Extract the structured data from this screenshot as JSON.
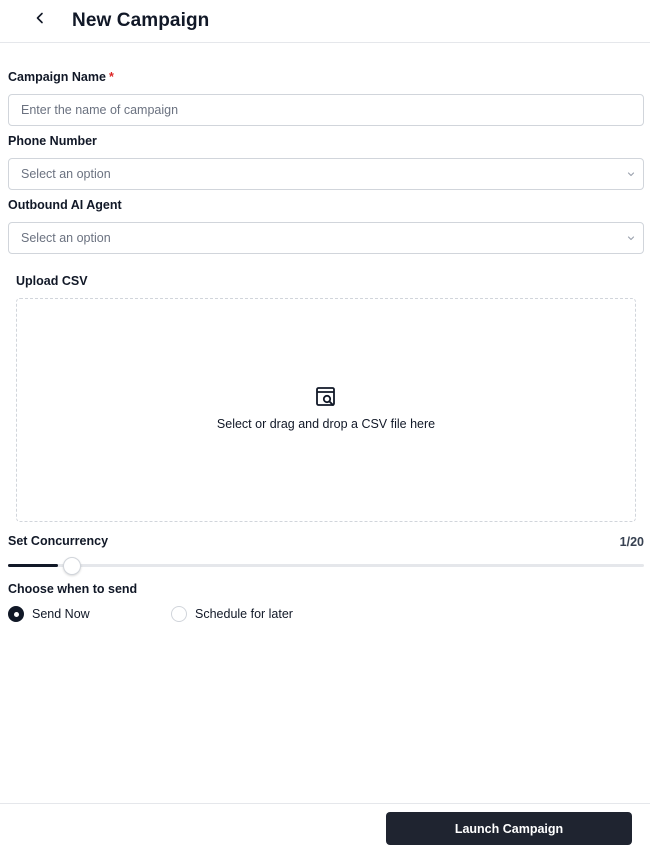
{
  "header": {
    "title": "New Campaign",
    "back_icon": "chevron-left-icon"
  },
  "form": {
    "campaign_name": {
      "label": "Campaign Name",
      "required_marker": "*",
      "value": "",
      "placeholder": "Enter the name of campaign"
    },
    "phone_number": {
      "label": "Phone Number",
      "selected": "Select an option"
    },
    "outbound_agent": {
      "label": "Outbound AI Agent",
      "selected": "Select an option"
    },
    "upload": {
      "label": "Upload CSV",
      "prompt": "Select or drag and drop a CSV file here",
      "icon": "file-search-icon"
    },
    "concurrency": {
      "label": "Set Concurrency",
      "value_text": "1/20",
      "value": 1,
      "max": 20
    },
    "send_time": {
      "label": "Choose when to send",
      "options": [
        {
          "label": "Send Now",
          "checked": true
        },
        {
          "label": "Schedule for later",
          "checked": false
        }
      ]
    }
  },
  "footer": {
    "launch_label": "Launch Campaign"
  },
  "colors": {
    "primary": "#1f2430",
    "required": "#dc2626",
    "border": "#d1d5db"
  }
}
